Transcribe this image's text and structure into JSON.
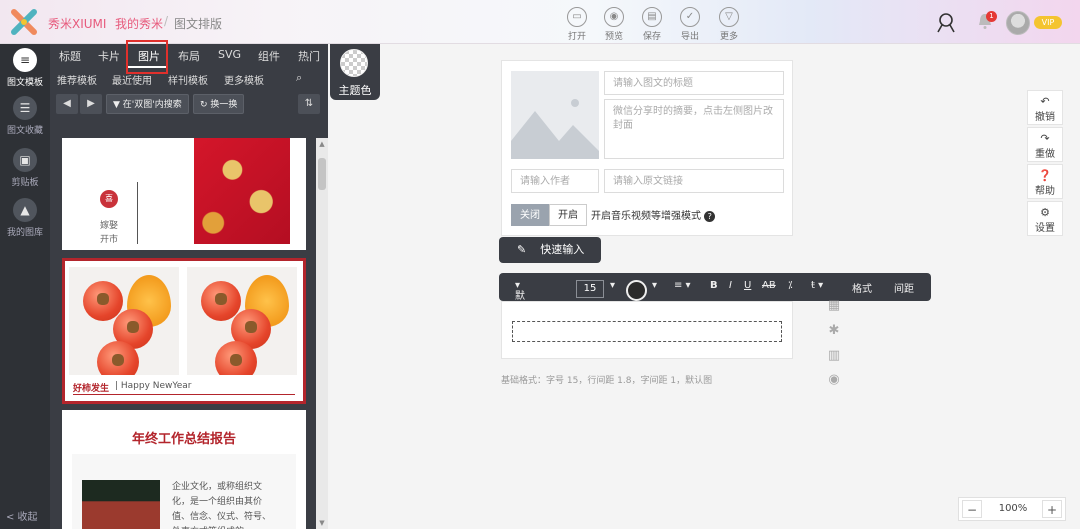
{
  "header": {
    "brand": "秀米XIUMI",
    "nav_my": "我的秀米",
    "nav_sep": "/",
    "nav_page": "图文排版",
    "tools": [
      {
        "label": "打开",
        "icon": "folder-icon"
      },
      {
        "label": "预览",
        "icon": "preview-icon"
      },
      {
        "label": "保存",
        "icon": "save-icon"
      },
      {
        "label": "导出",
        "icon": "export-icon"
      },
      {
        "label": "更多",
        "icon": "more-icon"
      }
    ],
    "notification_count": "1",
    "vip_label": "VIP"
  },
  "leftbar": {
    "items": [
      {
        "label": "图文模板",
        "icon": "list-icon"
      },
      {
        "label": "图文收藏",
        "icon": "collect-icon"
      },
      {
        "label": "剪贴板",
        "icon": "clipboard-icon"
      },
      {
        "label": "我的图库",
        "icon": "gallery-icon"
      }
    ],
    "collapse": "< 收起"
  },
  "panel": {
    "tabs": [
      "标题",
      "卡片",
      "图片",
      "布局",
      "SVG",
      "组件",
      "热门"
    ],
    "active_tab": "图片",
    "subtabs": [
      "推荐模板",
      "最近使用",
      "样刊模板",
      "更多模板"
    ],
    "filter_btn": "在'双图'内搜索",
    "swap_btn": "换一换",
    "cards": {
      "card1_seal": "喜",
      "card1_line1": "嫁娶",
      "card1_line2": "开市",
      "card2_title": "好柿发生",
      "card2_sub": "| Happy NewYear",
      "card3_title": "年终工作总结报告",
      "card3_text": "企业文化，或称组织文化，是一个组织由其价值、信念、仪式、符号、处事方式等组成的"
    }
  },
  "theme": {
    "label": "主题色"
  },
  "editor": {
    "title_placeholder": "请输入图文的标题",
    "summary_placeholder": "微信分享时的摘要，点击左侧图片改封面",
    "author_placeholder": "请输入作者",
    "link_placeholder": "请输入原文链接",
    "toggle_off": "关闭",
    "toggle_on": "开启",
    "enhance_text": "开启音乐视频等增强模式",
    "help": "?"
  },
  "quick_input": {
    "label": "快速输入"
  },
  "format_bar": {
    "font": "默认字体",
    "size": "15",
    "bold": "B",
    "italic": "I",
    "underline": "U",
    "strike": "AB",
    "format": "格式",
    "spacing": "间距"
  },
  "base_format": "基础格式：字号 15，行间距 1.8，字间距 1，默认图",
  "right_tools": [
    {
      "label": "撤销",
      "icon": "undo-icon"
    },
    {
      "label": "重做",
      "icon": "redo-icon"
    },
    {
      "label": "帮助",
      "icon": "help-icon"
    },
    {
      "label": "设置",
      "icon": "settings-icon"
    }
  ],
  "zoom": {
    "value": "100%",
    "minus": "−",
    "plus": "+"
  },
  "colors": {
    "accent": "#e75a7c",
    "dark_panel": "#3a3d44",
    "highlight_red": "#e0302c"
  }
}
